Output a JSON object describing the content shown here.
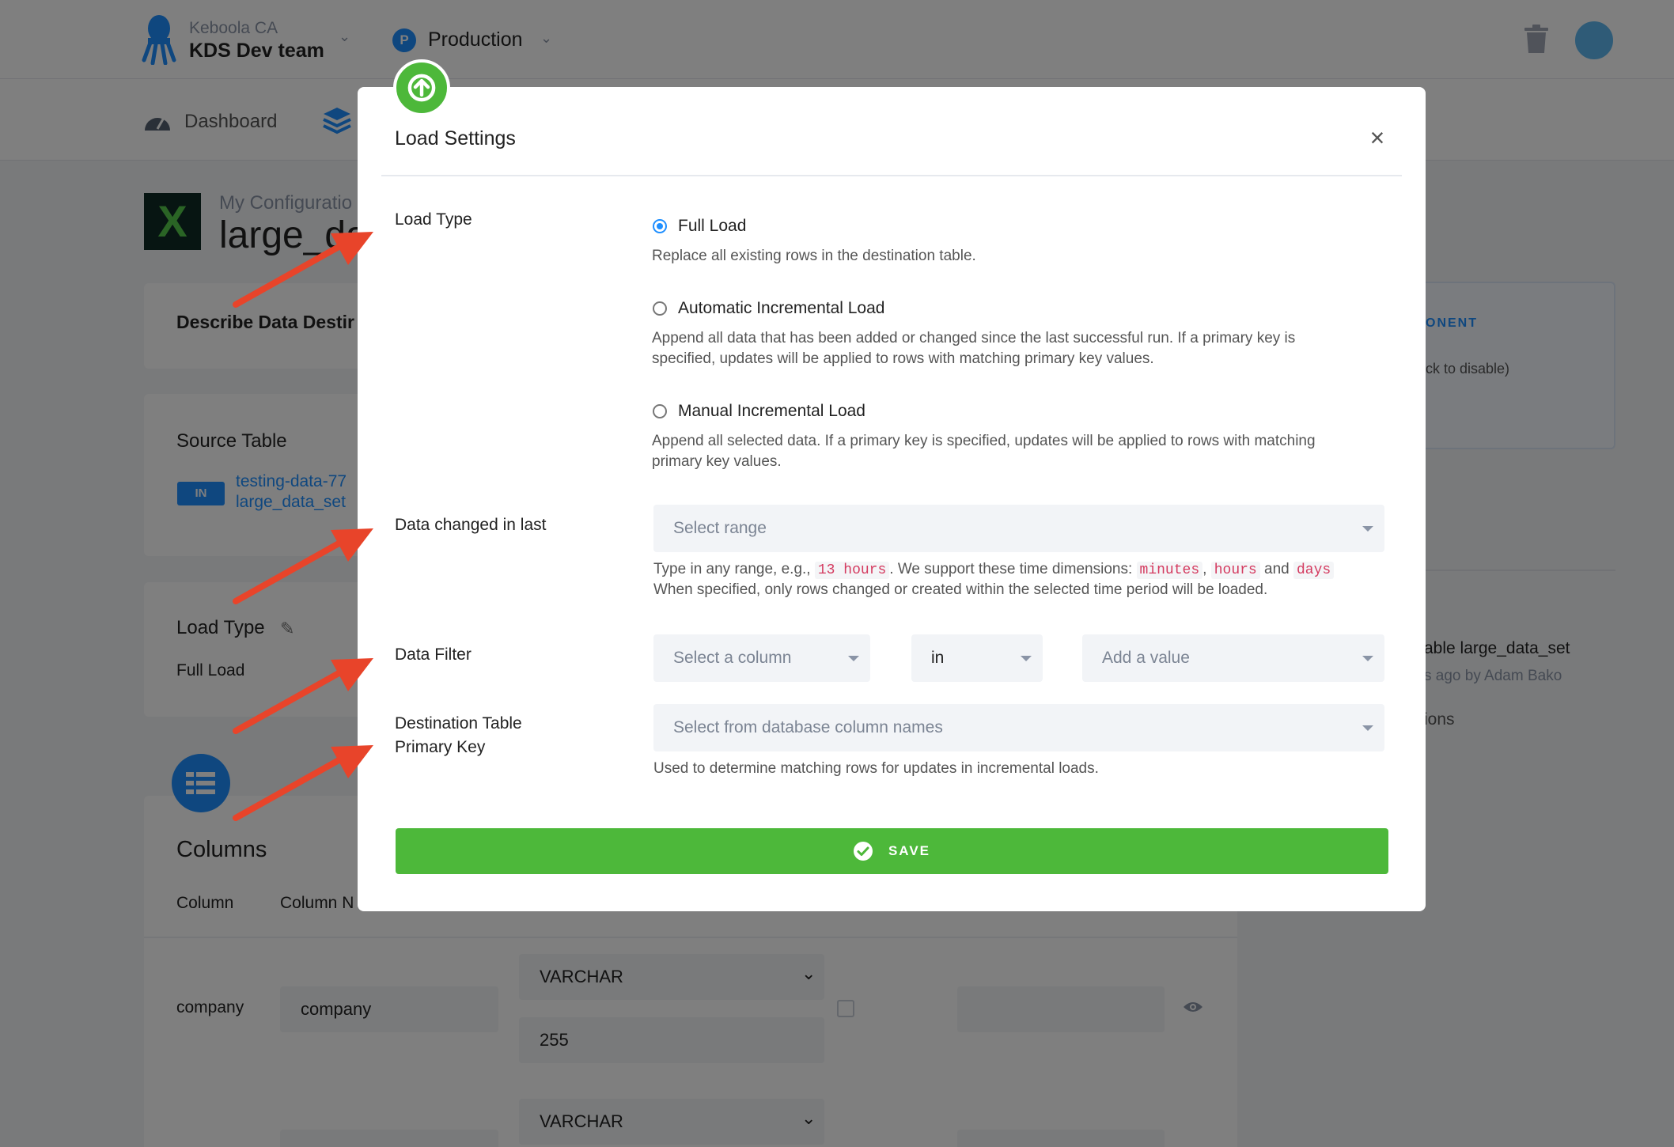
{
  "header": {
    "org_small": "Keboola CA",
    "org_name": "KDS Dev team",
    "env_badge": "P",
    "env_label": "Production"
  },
  "nav": {
    "dashboard": "Dashboard"
  },
  "config": {
    "subtitle": "My Configuratio",
    "title": "large_da"
  },
  "cards": {
    "describe": "Describe Data Destir",
    "source_title": "Source Table",
    "in_badge": "IN",
    "source_link_1": "testing-data-77",
    "source_link_2": "large_data_set",
    "load_type_title": "Load Type",
    "load_type_value": "Full Load",
    "columns_title": "Columns",
    "col_header_1": "Column",
    "col_header_2": "Column N"
  },
  "table": {
    "rows": [
      {
        "column": "company",
        "name": "company",
        "type": "VARCHAR",
        "length": "255"
      },
      {
        "column": "",
        "name": "",
        "type": "VARCHAR",
        "length": ""
      }
    ]
  },
  "right": {
    "component_label": "ONENT",
    "disable_hint": "ck to disable)",
    "activity_title": "able large_data_set",
    "activity_meta": "s ago by Adam Bako",
    "activity_more": "ions"
  },
  "modal": {
    "title": "Load Settings",
    "close": "×",
    "load_type_label": "Load Type",
    "options": [
      {
        "label": "Full Load",
        "help": "Replace all existing rows in the destination table.",
        "checked": true
      },
      {
        "label": "Automatic Incremental Load",
        "help_1": "Append all data that has been added or changed since the last successful run. If a primary key is",
        "help_2": "specified, updates will be applied to rows with matching primary key values.",
        "checked": false
      },
      {
        "label": "Manual Incremental Load",
        "help_1": "Append all selected data. If a primary key is specified, updates will be applied to rows with matching",
        "help_2": "primary key values.",
        "checked": false
      }
    ],
    "changed_label": "Data changed in last",
    "changed_placeholder": "Select range",
    "changed_help_prefix": "Type in any range, e.g.,",
    "changed_help_example": "13 hours",
    "changed_help_mid": ". We support these time dimensions:",
    "dim_minutes": "minutes",
    "dim_hours": "hours",
    "dim_and": "and",
    "dim_days": "days",
    "changed_help_2": "When specified, only rows changed or created within the selected time period will be loaded.",
    "filter_label": "Data Filter",
    "filter_column_placeholder": "Select a column",
    "filter_operator": "in",
    "filter_value_placeholder": "Add a value",
    "pk_label_1": "Destination Table",
    "pk_label_2": "Primary Key",
    "pk_placeholder": "Select from database column names",
    "pk_help": "Used to determine matching rows for updates in incremental loads.",
    "save_label": "SAVE"
  },
  "colors": {
    "accent": "#1f8fff",
    "success": "#4db83a",
    "annotation_arrow": "#e8442a"
  }
}
